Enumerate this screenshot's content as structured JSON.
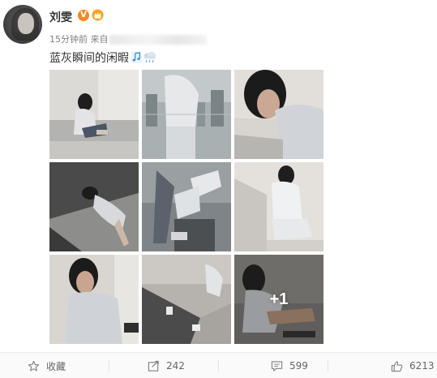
{
  "user": {
    "name": "刘雯",
    "verified_badge": "V",
    "time": "15分钟前 来自"
  },
  "post": {
    "text": "蓝灰瞬间的闲暇",
    "more_count": "+1"
  },
  "actions": {
    "favorite_label": "收藏",
    "repost_count": "242",
    "comment_count": "599",
    "like_count": "6213"
  },
  "colors": {
    "accent_badge": "#f78a1d",
    "text_primary": "#333333",
    "text_meta": "#808080"
  },
  "icons": [
    "star-icon",
    "repost-icon",
    "comment-icon",
    "like-icon",
    "music-note-icon",
    "cloud-rain-icon",
    "crown-icon"
  ]
}
